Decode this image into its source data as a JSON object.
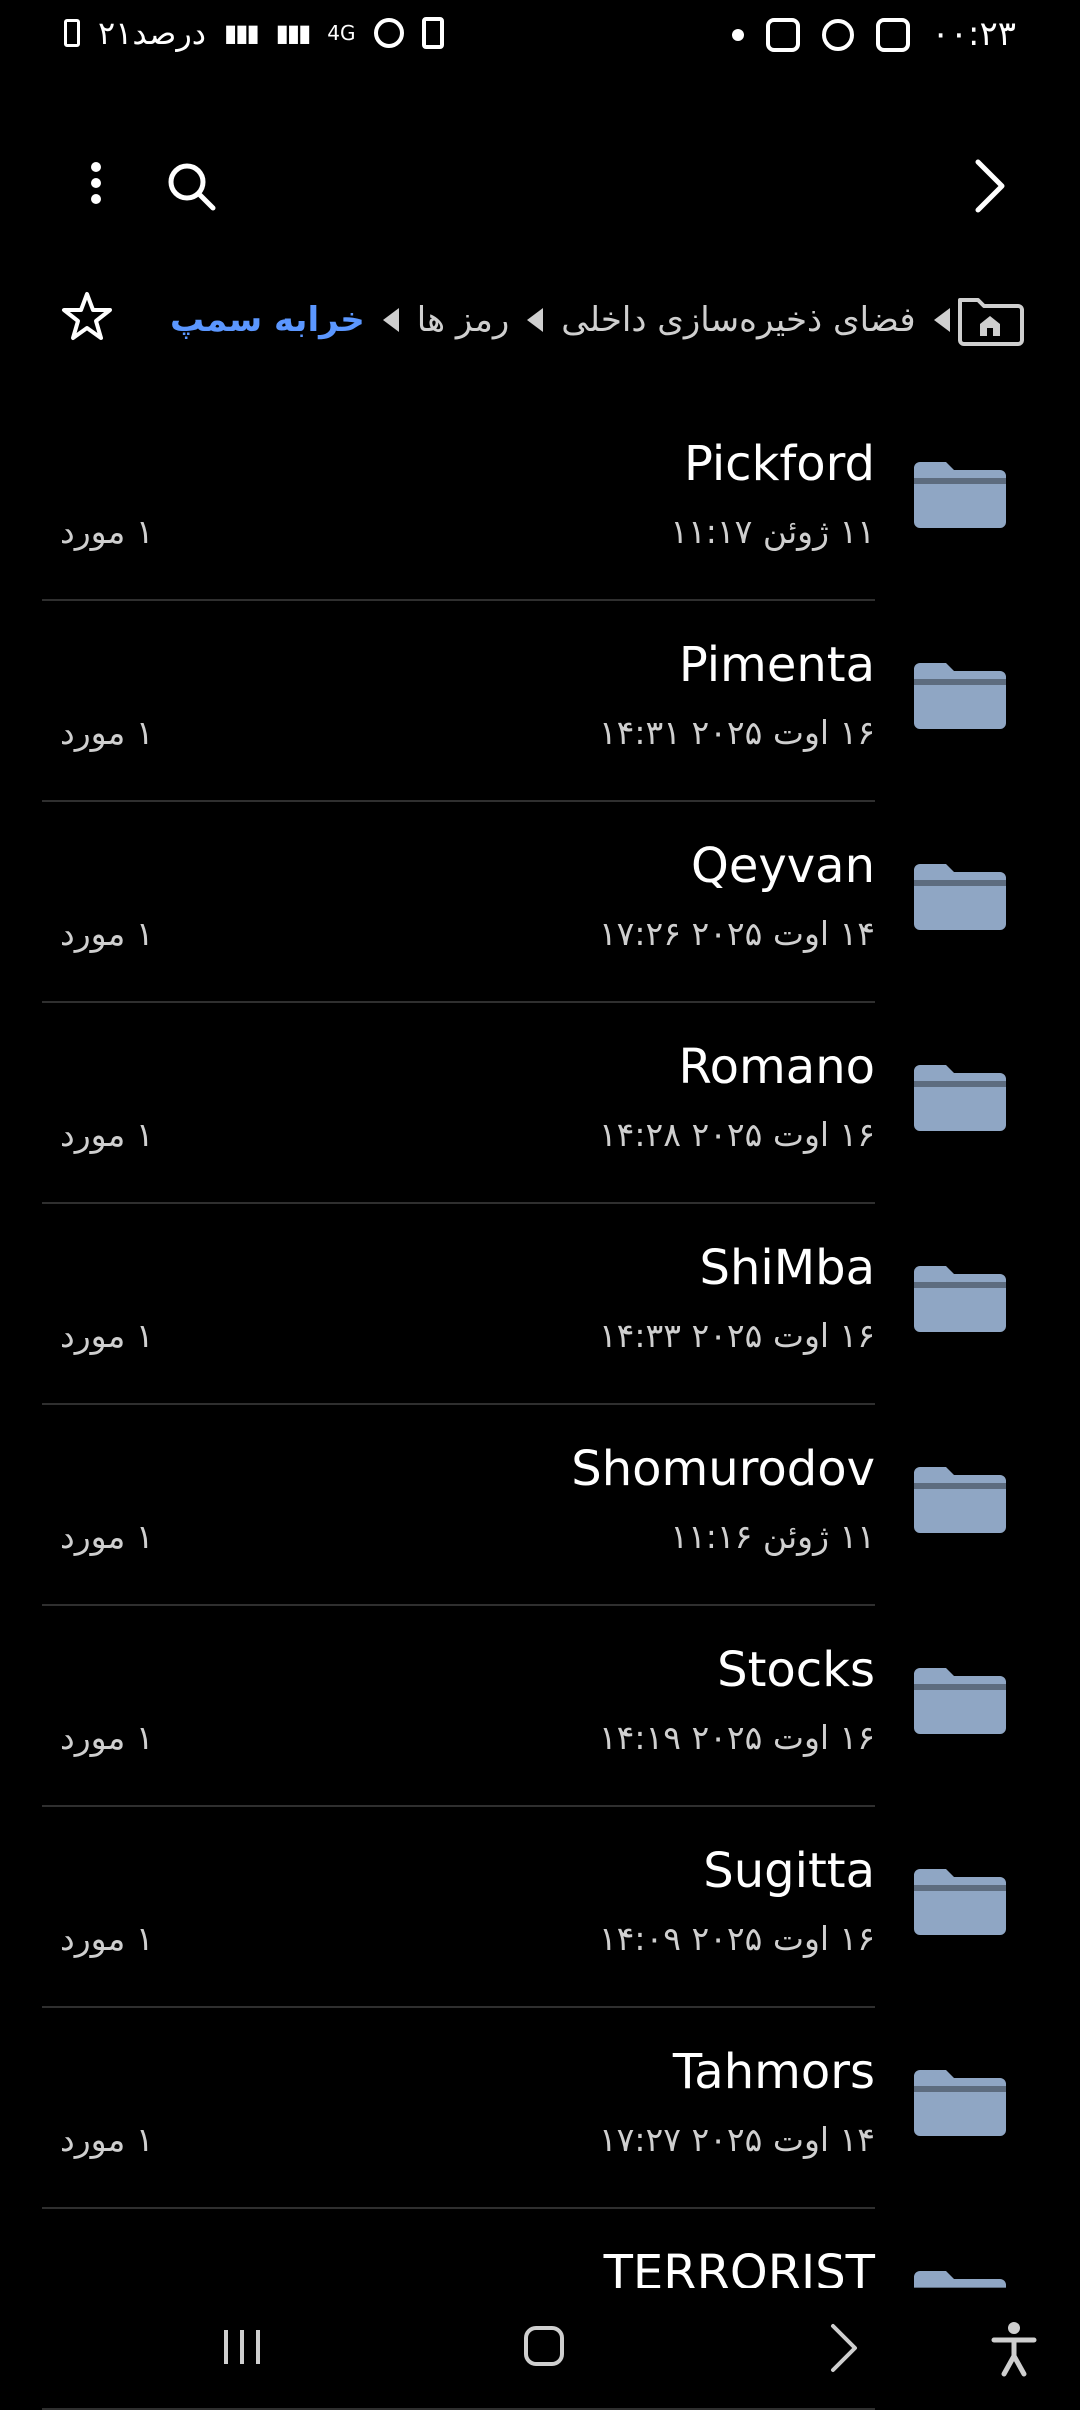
{
  "status_bar": {
    "time": "۰۰:۲۳",
    "battery_text": "۲۱درصد",
    "network_label": "4G"
  },
  "breadcrumb": {
    "active": "خرابه سمپ",
    "items": [
      "رمز ها",
      "فضای ذخیره‌سازی داخلی"
    ]
  },
  "files": [
    {
      "name": "Pickford",
      "date": "۱۱ ژوئن ۱۱:۱۷",
      "count": "۱ مورد"
    },
    {
      "name": "Pimenta",
      "date": "۱۶ اوت ۲۰۲۵ ۱۴:۳۱",
      "count": "۱ مورد"
    },
    {
      "name": "Qeyvan",
      "date": "۱۴ اوت ۲۰۲۵ ۱۷:۲۶",
      "count": "۱ مورد"
    },
    {
      "name": "Romano",
      "date": "۱۶ اوت ۲۰۲۵ ۱۴:۲۸",
      "count": "۱ مورد"
    },
    {
      "name": "ShiMba",
      "date": "۱۶ اوت ۲۰۲۵ ۱۴:۳۳",
      "count": "۱ مورد"
    },
    {
      "name": "Shomurodov",
      "date": "۱۱ ژوئن ۱۱:۱۶",
      "count": "۱ مورد"
    },
    {
      "name": "Stocks",
      "date": "۱۶ اوت ۲۰۲۵ ۱۴:۱۹",
      "count": "۱ مورد"
    },
    {
      "name": "Sugitta",
      "date": "۱۶ اوت ۲۰۲۵ ۱۴:۰۹",
      "count": "۱ مورد"
    },
    {
      "name": "Tahmors",
      "date": "۱۴ اوت ۲۰۲۵ ۱۷:۲۷",
      "count": "۱ مورد"
    },
    {
      "name": "TERRORIST",
      "date": "",
      "count": ""
    }
  ],
  "colors": {
    "background": "#000000",
    "accent": "#5b97ff",
    "folder": "#8fa6c4",
    "text_secondary": "#cfcfcf"
  }
}
